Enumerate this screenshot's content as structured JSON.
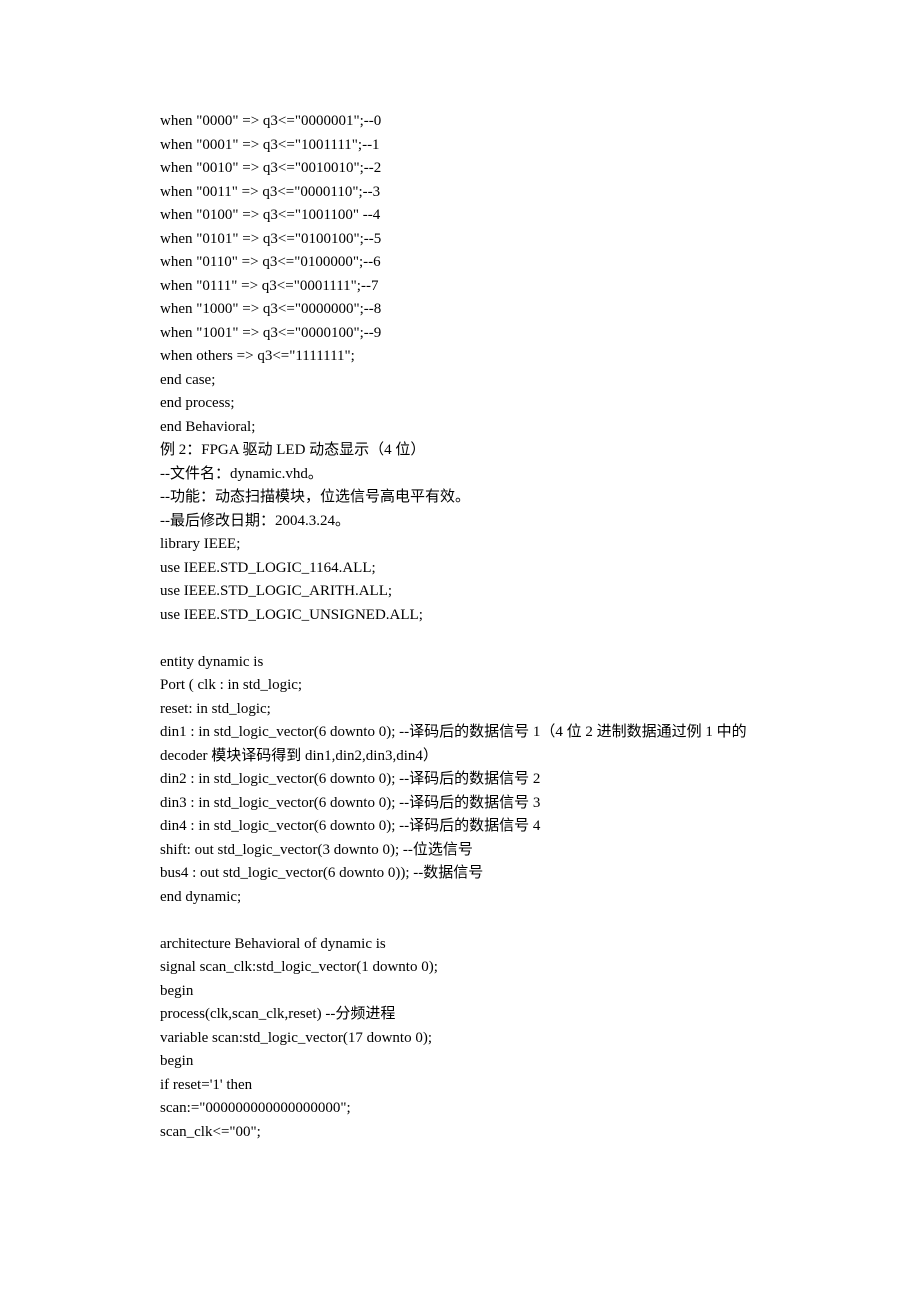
{
  "lines": [
    "when \"0000\" => q3<=\"0000001\";--0",
    "when \"0001\" => q3<=\"1001111\";--1",
    "when \"0010\" => q3<=\"0010010\";--2",
    "when \"0011\" => q3<=\"0000110\";--3",
    "when \"0100\" => q3<=\"1001100\" --4",
    "when \"0101\" => q3<=\"0100100\";--5",
    "when \"0110\" => q3<=\"0100000\";--6",
    "when \"0111\" => q3<=\"0001111\";--7",
    "when \"1000\" => q3<=\"0000000\";--8",
    "when \"1001\" => q3<=\"0000100\";--9",
    "when others => q3<=\"1111111\";",
    "end case;",
    "end process;",
    "end Behavioral;",
    "例 2：FPGA 驱动 LED 动态显示（4 位）",
    "--文件名：dynamic.vhd。",
    "--功能：动态扫描模块，位选信号高电平有效。",
    "--最后修改日期：2004.3.24。",
    "library IEEE;",
    "use IEEE.STD_LOGIC_1164.ALL;",
    "use IEEE.STD_LOGIC_ARITH.ALL;",
    "use IEEE.STD_LOGIC_UNSIGNED.ALL;",
    "",
    "entity dynamic is",
    "Port ( clk : in std_logic;",
    "reset: in std_logic;",
    "din1 : in std_logic_vector(6 downto 0); --译码后的数据信号 1（4 位 2 进制数据通过例 1 中的 decoder 模块译码得到 din1,din2,din3,din4）",
    "din2 : in std_logic_vector(6 downto 0); --译码后的数据信号 2",
    "din3 : in std_logic_vector(6 downto 0); --译码后的数据信号 3",
    "din4 : in std_logic_vector(6 downto 0); --译码后的数据信号 4",
    "shift: out std_logic_vector(3 downto 0); --位选信号",
    "bus4 : out std_logic_vector(6 downto 0)); --数据信号",
    "end dynamic;",
    "",
    "architecture Behavioral of dynamic is",
    "signal scan_clk:std_logic_vector(1 downto 0);",
    "begin",
    "process(clk,scan_clk,reset) --分频进程",
    "variable scan:std_logic_vector(17 downto 0);",
    "begin",
    "if reset='1' then",
    "scan:=\"000000000000000000\";",
    "scan_clk<=\"00\";"
  ]
}
